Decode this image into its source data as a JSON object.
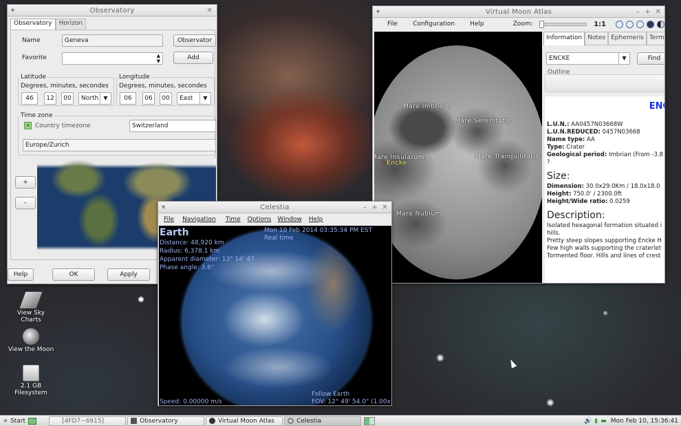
{
  "observatory": {
    "title": "Observatory",
    "tabs": [
      "Observatory",
      "Horizon"
    ],
    "name_label": "Name",
    "name_value": "Geneva",
    "observatory_button": "Observator",
    "favorite_label": "Favorite",
    "add_button": "Add",
    "latitude": {
      "legend": "Latitude",
      "hint": "Degrees, minutes, secondes",
      "deg": "46",
      "min": "12",
      "sec": "00",
      "hemisphere": "North"
    },
    "longitude": {
      "legend": "Longitude",
      "hint": "Degrees, minutes, secondes",
      "deg": "06",
      "min": "06",
      "sec": "00",
      "hemisphere": "East"
    },
    "timezone": {
      "legend": "Time zone",
      "country_checkbox": "Country timezone",
      "country_value": "Switzerland",
      "zone_value": "Europe/Zurich"
    },
    "zoom_in": "+",
    "zoom_out": "–",
    "help_button": "Help",
    "ok_button": "OK",
    "apply_button": "Apply"
  },
  "moon": {
    "title": "Virtual Moon Atlas",
    "menu": [
      "File",
      "Configuration",
      "Help"
    ],
    "zoom_label": "Zoom:",
    "zoom_ratio": "1:1",
    "tabs": [
      "Information",
      "Notes",
      "Ephemeris",
      "Termi"
    ],
    "search_value": "ENCKE",
    "find_button": "Find",
    "outline_label": "Outline",
    "labels": [
      "Mare Imbrium",
      "Mare Serenitatis",
      "Mare Insularum",
      "Encke",
      "Mare Tranquilitatis",
      "Mare Nubium"
    ],
    "info": {
      "heading": "ENC",
      "lun_label": "L.U.N.:",
      "lun_value": "AA0457N03668W",
      "lun_reduced_label": "L.U.N.REDUCED:",
      "lun_reduced_value": "0457N03668",
      "name_type_label": "Name type:",
      "name_type_value": "AA",
      "type_label": "Type:",
      "type_value": "Crater",
      "geo_label": "Geological period:",
      "geo_value": "Imbrian (From -3.8",
      "geo_cont": "?",
      "size_heading": "Size:",
      "dimension_label": "Dimension:",
      "dimension_value": "30.0x29.0Km / 18.0x18.0",
      "height_label": "Height:",
      "height_value": "750.0' / 2300.0ft",
      "ratio_label": "Height/Wide ratio:",
      "ratio_value": "0.0259",
      "description_heading": "Description:",
      "description_lines": [
        "Isolated hexagonal formation situated i",
        "hills.",
        "Pretty steep slopes supporting Encke H",
        "Few high walls supporting the craterlet",
        "Tormented floor. Hills and lines of crest"
      ]
    }
  },
  "celestia": {
    "title": "Celestia",
    "menu": [
      "File",
      "Navigation",
      "Time",
      "Options",
      "Window",
      "Help"
    ],
    "object_name": "Earth",
    "distance": "Distance: 48,920 km",
    "radius": "Radius: 6,378.1 km",
    "apparent": "Apparent diameter: 13° 14' 47",
    "phase": "Phase angle: 3.6°",
    "datetime": "Mon 10 Feb 2014 03:35:34 PM EST",
    "realtime": "Real time",
    "follow": "Follow Earth",
    "fov": "FOV: 12° 49' 54.0\" (1.00x)",
    "speed": "Speed: 0.00000 m/s"
  },
  "desktop": {
    "icons": [
      "View Sky Charts",
      "View the Moon",
      "2.1 GB Filesystem"
    ]
  },
  "taskbar": {
    "start": "Start",
    "tasks": [
      "[4FD7~6915]",
      "Observatory",
      "Virtual Moon Atlas",
      "Celestia"
    ],
    "clock": "Mon Feb 10, 15:36:41"
  }
}
